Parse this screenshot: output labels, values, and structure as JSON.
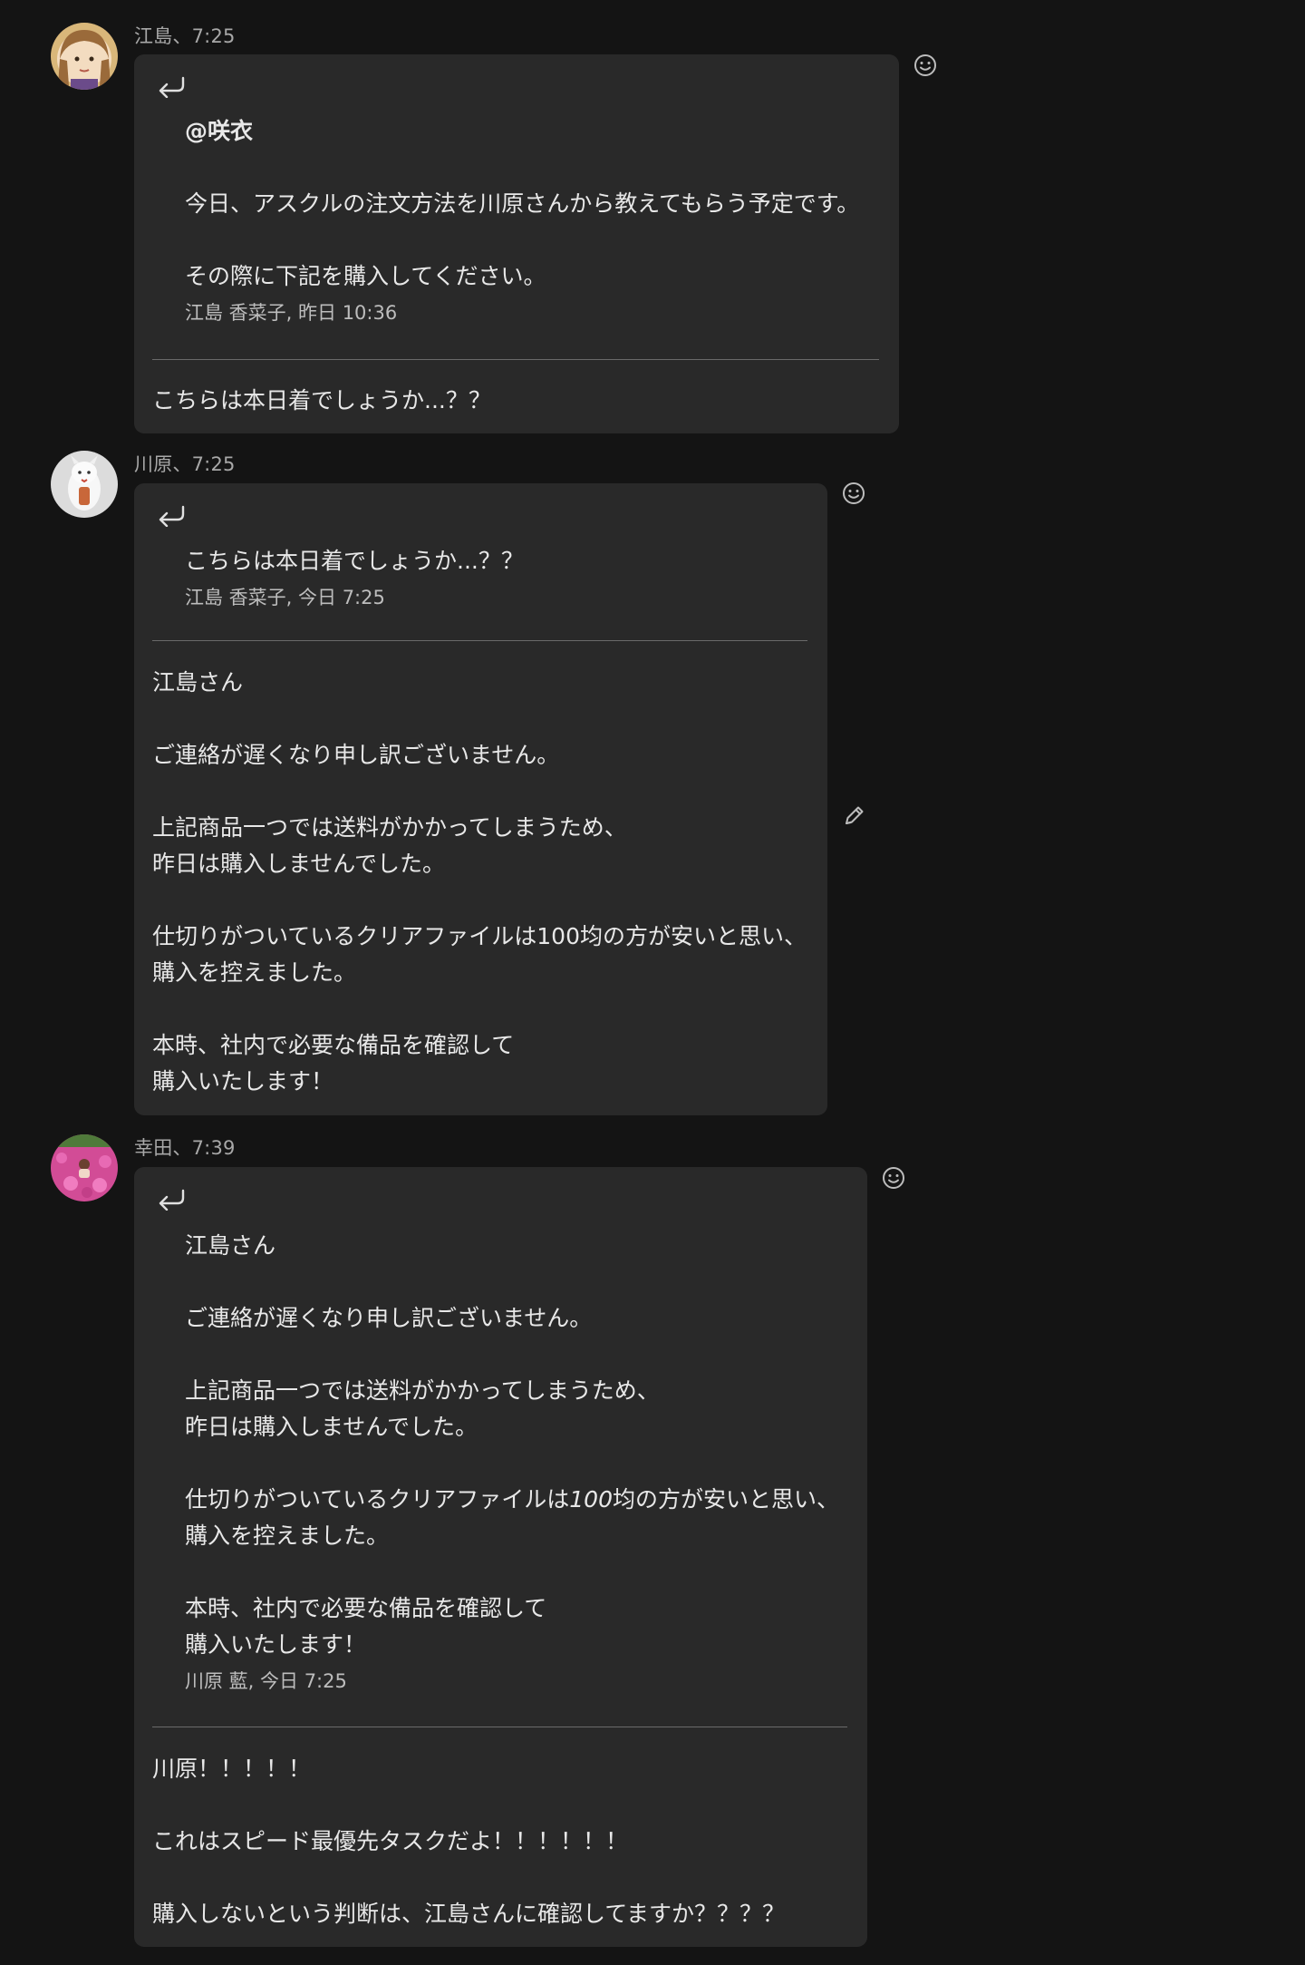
{
  "messages": [
    {
      "sender": "江島",
      "time": "7:25",
      "quote": {
        "lines": [
          "@咲衣",
          "",
          "今日、アスクルの注文方法を川原さんから教えてもらう予定です。",
          "",
          "その際に下記を購入してください。"
        ],
        "author": "江島 香菜子, 昨日 10:36"
      },
      "body": [
        "こちらは本日着でしょうか...？？"
      ]
    },
    {
      "sender": "川原",
      "time": "7:25",
      "quote": {
        "lines": [
          "こちらは本日着でしょうか...？？"
        ],
        "author": "江島 香菜子, 今日 7:25"
      },
      "body": [
        "江島さん",
        "",
        "ご連絡が遅くなり申し訳ございません。",
        "",
        "上記商品一つでは送料がかかってしまうため、",
        "昨日は購入しませんでした。",
        "",
        "仕切りがついているクリアファイルは100均の方が安いと思い、",
        "購入を控えました。",
        "",
        "本時、社内で必要な備品を確認して",
        "購入いたします！"
      ]
    },
    {
      "sender": "幸田",
      "time": "7:39",
      "quote": {
        "lines": [
          "江島さん",
          "",
          "ご連絡が遅くなり申し訳ございません。",
          "",
          "上記商品一つでは送料がかかってしまうため、",
          "昨日は購入しませんでした。",
          "",
          "仕切りがついているクリアファイルは",
          "購入を控えました。",
          "",
          "本時、社内で必要な備品を確認して",
          "購入いたします！"
        ],
        "italic_fragment": "100",
        "fragment_tail": "均の方が安いと思い、",
        "author": "川原 藍, 今日 7:25"
      },
      "body": [
        "川原！！！！！",
        "",
        "これはスピード最優先タスクだよ！！！！！！",
        "",
        "購入しないという判断は、江島さんに確認してますか？？？？"
      ]
    }
  ],
  "meta_separator": "、",
  "icons": {
    "reply": "reply-arrow-icon",
    "react": "smiley-icon",
    "edit": "pencil-icon"
  },
  "colors": {
    "background": "#141414",
    "bubble": "#292929",
    "text": "#e8e8e8",
    "meta": "#a8a8a8"
  }
}
